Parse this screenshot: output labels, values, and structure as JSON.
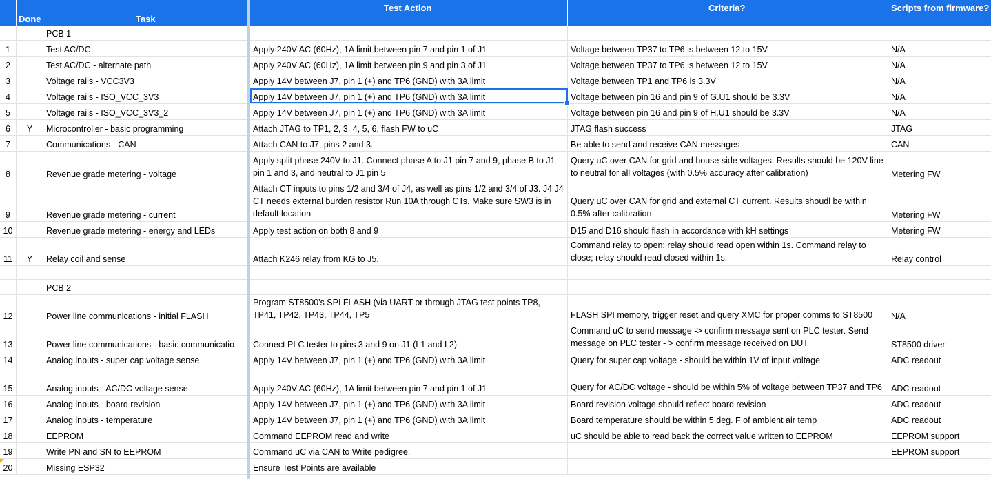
{
  "header": {
    "done": "Done",
    "task": "Task",
    "test_action": "Test Action",
    "criteria": "Criteria?",
    "scripts": "Scripts from firmware?"
  },
  "rows": [
    {
      "num": "",
      "done": "",
      "task": "PCB 1",
      "test": "",
      "crit": "",
      "scr": ""
    },
    {
      "num": "1",
      "done": "",
      "task": "Test AC/DC",
      "test": "Apply 240V AC (60Hz), 1A limit between pin 7 and pin 1 of J1",
      "crit": "Voltage between TP37 to TP6 is between 12 to 15V",
      "scr": "N/A"
    },
    {
      "num": "2",
      "done": "",
      "task": "Test AC/DC - alternate path",
      "test": "Apply 240V AC (60Hz), 1A limit between pin 9 and pin 3 of J1",
      "crit": "Voltage between TP37 to TP6 is between 12 to 15V",
      "scr": "N/A"
    },
    {
      "num": "3",
      "done": "",
      "task": "Voltage rails - VCC3V3",
      "test": "Apply 14V between J7, pin 1 (+) and TP6 (GND) with 3A limit",
      "crit": "Voltage between TP1 and TP6 is 3.3V",
      "scr": "N/A"
    },
    {
      "num": "4",
      "done": "",
      "task": "Voltage rails - ISO_VCC_3V3",
      "test": "Apply 14V between J7, pin 1 (+) and TP6 (GND) with 3A limit",
      "crit": "Voltage between pin 16 and pin 9 of G.U1 should be 3.3V",
      "scr": "N/A"
    },
    {
      "num": "5",
      "done": "",
      "task": "Voltage rails - ISO_VCC_3V3_2",
      "test": "Apply 14V between J7, pin 1 (+) and TP6 (GND) with 3A limit",
      "crit": "Voltage between pin 16 and pin 9 of H.U1 should be 3.3V",
      "scr": "N/A"
    },
    {
      "num": "6",
      "done": "Y",
      "task": "Microcontroller - basic programming",
      "test": "Attach JTAG to TP1, 2, 3, 4, 5, 6, flash FW to uC",
      "crit": "JTAG flash success",
      "scr": "JTAG"
    },
    {
      "num": "7",
      "done": "",
      "task": "Communications - CAN",
      "test": "Attach CAN to J7, pins 2 and 3.",
      "crit": "Be able to send and receive CAN messages",
      "scr": "CAN"
    },
    {
      "num": "8",
      "done": "",
      "task": "Revenue grade metering - voltage",
      "test": "Apply split phase 240V to J1. Connect phase A to J1 pin 7 and 9, phase B to J1 pin 1 and 3, and neutral to J1 pin 5",
      "crit": "Query uC over CAN for grid and house side voltages. Results should be 120V line to neutral for all voltages (with 0.5% accuracy after calibration)",
      "scr": "Metering FW"
    },
    {
      "num": "9",
      "done": "",
      "task": "Revenue grade metering - current",
      "test": "Attach CT inputs to pins 1/2 and 3/4 of J4, as well as pins 1/2 and 3/4 of J3. J4 J4 CT needs external burden resistor Run 10A through CTs. Make sure SW3 is in default location",
      "crit": "Query uC over CAN for grid and external CT current. Results shoudl be within 0.5% after calibration",
      "scr": "Metering FW"
    },
    {
      "num": "10",
      "done": "",
      "task": "Revenue grade metering - energy and LEDs",
      "test": "Apply test action on both 8 and 9",
      "crit": "D15 and D16 should flash in accordance with kH settings",
      "scr": "Metering FW"
    },
    {
      "num": "11",
      "done": "Y",
      "task": "Relay coil and sense",
      "test": "Attach K246 relay from KG to J5.",
      "crit": "Command relay to open; relay should read open within 1s. Command relay to close; relay should read closed within 1s.",
      "scr": "Relay control"
    },
    {
      "num": "",
      "done": "",
      "task": "",
      "test": "",
      "crit": "",
      "scr": ""
    },
    {
      "num": "",
      "done": "",
      "task": "PCB 2",
      "test": "",
      "crit": "",
      "scr": ""
    },
    {
      "num": "12",
      "done": "",
      "task": "Power line communications - initial FLASH",
      "test": "Program ST8500's SPI FLASH (via UART or through JTAG test points TP8, TP41, TP42, TP43, TP44, TP5",
      "crit": "FLASH SPI memory, trigger reset and query XMC for proper comms to ST8500",
      "scr": "N/A"
    },
    {
      "num": "13",
      "done": "",
      "task": "Power line communications - basic communicatio",
      "test": "Connect PLC tester to pins 3 and 9 on J1 (L1 and L2)",
      "crit": "Command uC to send message -> confirm message sent on PLC tester. Send message on PLC tester - > confirm message received on DUT",
      "scr": "ST8500 driver"
    },
    {
      "num": "14",
      "done": "",
      "task": "Analog inputs - super cap voltage sense",
      "test": "Apply 14V between J7, pin 1 (+) and TP6 (GND) with 3A limit",
      "crit": "Query for super cap voltage - should be within 1V of input voltage",
      "scr": "ADC readout"
    },
    {
      "num": "15",
      "done": "",
      "task": "Analog inputs - AC/DC voltage sense",
      "test": "Apply 240V AC (60Hz), 1A limit between pin 7 and pin 1 of J1",
      "crit": "Query for AC/DC voltage - should be within 5% of voltage between TP37 and TP6",
      "scr": "ADC readout"
    },
    {
      "num": "16",
      "done": "",
      "task": "Analog inputs - board revision",
      "test": "Apply 14V between J7, pin 1 (+) and TP6 (GND) with 3A limit",
      "crit": "Board revision voltage should reflect board revision",
      "scr": "ADC readout"
    },
    {
      "num": "17",
      "done": "",
      "task": "Analog inputs - temperature",
      "test": "Apply 14V between J7, pin 1 (+) and TP6 (GND) with 3A limit",
      "crit": "Board temperature should be within 5 deg. F of ambient air temp",
      "scr": "ADC readout"
    },
    {
      "num": "18",
      "done": "",
      "task": "EEPROM",
      "test": "Command EEPROM read and write",
      "crit": "uC should be able to read back the correct value written to EEPROM",
      "scr": "EEPROM support"
    },
    {
      "num": "19",
      "done": "",
      "task": "Write PN and SN to EEPROM",
      "test": "Command uC via CAN to Write pedigree.",
      "crit": "",
      "scr": "EEPROM support"
    },
    {
      "num": "20",
      "done": "",
      "task": "Missing ESP32",
      "test": "Ensure Test Points are available",
      "crit": "",
      "scr": ""
    }
  ]
}
